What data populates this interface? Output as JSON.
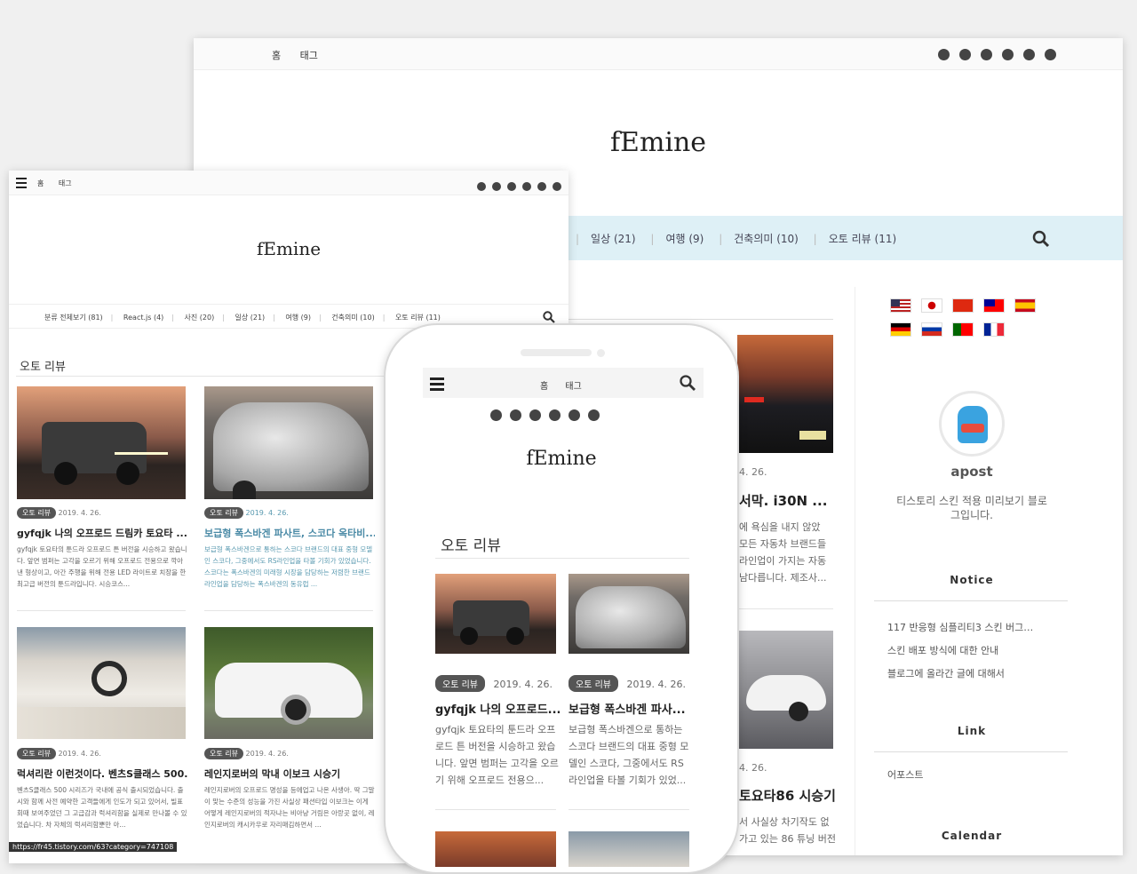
{
  "desktop": {
    "menu": [
      "홈",
      "태그"
    ],
    "logo": "fEmine",
    "nav": [
      "일상 (21)",
      "여행 (9)",
      "건축의미 (10)",
      "오토 리뷰 (11)"
    ],
    "post1_date": "4. 26.",
    "post1_title": "서막. i30N ...",
    "post1_excerpt": [
      "에 욕심을 내지 않았",
      "모든 자동차 브랜드들",
      "라인업이 가지는 자동",
      "남다릅니다. 제조사..."
    ],
    "post2_date": "4. 26.",
    "post2_title": "토요타86 시승기",
    "post2_excerpt": [
      "서 사실상 차기작도 없",
      "가고 있는 86 튜닝 버전"
    ],
    "profile_name": "apost",
    "profile_desc": "티스토리 스킨 적용 미리보기 블로그입니다.",
    "notice_title": "Notice",
    "notices": [
      "117 반응형 심플리티3 스킨 버그…",
      "스킨 배포 방식에 대한 안내",
      "블로그에 올라간 글에 대해서"
    ],
    "link_title": "Link",
    "links": [
      "어포스트"
    ],
    "calendar_title": "Calendar"
  },
  "tablet": {
    "menu": [
      "홈",
      "태그"
    ],
    "logo": "fEmine",
    "nav": [
      "분류 전체보기 (81)",
      "React.js (4)",
      "사진 (20)",
      "일상 (21)",
      "여행 (9)",
      "건축의미 (10)",
      "오토 리뷰 (11)"
    ],
    "category_heading": "오토 리뷰",
    "posts": [
      {
        "tag": "오토 리뷰",
        "date": "2019. 4. 26.",
        "title": "gyfqjk 나의 오프로드 드림카 토요타 ...",
        "excerpt": "gyfqjk 토요타의 툰드라 오프로드 튼 버전을 시승하고 왔습니다. 앞면 범퍼는 고각을 오르기 위해 오프로드 전용으로 깍아낸 형상이고, 아간 주행을 위해 전용 LED 라이트로 치장을 한 최고급 버전의 툰드라입니다. 시승코스..."
      },
      {
        "tag": "오토 리뷰",
        "date": "2019. 4. 26.",
        "title": "보급형 폭스바겐 파사트, 스코다 옥타비...",
        "excerpt": "보급형 폭스바겐으로 통하는 스코다 브랜드의 대표 중형 모델인 스코다, 그중에서도 RS라인업을 타볼 기회가 있었습니다. 스코다는 폭스바겐의 미래형 시장을 담당하는 저렴한 브랜드 라인업을 담당하는 폭스바겐의 동유럽 ..."
      },
      {
        "tag": "오토 리뷰",
        "date": "2019. 4. 26.",
        "title": "럭셔리란 이런것이다. 벤츠S클래스 500...",
        "excerpt": "벤츠S클래스 500 시리즈가 국내에 공식 출시되었습니다. 출시와 함께 사전 예약한 고객들에게 인도가 되고 있어서, 빌표회때 보여주었던 그 고급감과 럭셔리함을 실제로 만나볼 수 있었습니다. 차 자체의 럭셔리함뿐만 아..."
      },
      {
        "tag": "오토 리뷰",
        "date": "2019. 4. 26.",
        "title": "레인지로버의 막내 이보크 시승기",
        "excerpt": "레인지로버의 오프로드 명성을 등에업고 나온 사생아. 딱 그말이 맞는 수준의 성능을 가진 사실상 패션타입 이보크는 이게 어떻게 레인지로버의 적자냐는 비아냥 거림은 아랑곳 없이, 레인지로버의 캐시카우로 자리매김하면서 ..."
      }
    ]
  },
  "phone": {
    "menu": [
      "홈",
      "태그"
    ],
    "logo": "fEmine",
    "category_heading": "오토 리뷰",
    "posts": [
      {
        "tag": "오토 리뷰",
        "date": "2019. 4. 26.",
        "title": "gyfqjk 나의 오프로드...",
        "excerpt": "gyfqjk 토요타의 툰드라 오프로드 튼 버전을 시승하고 왔습니다. 앞면 범퍼는 고각을 오르기 위해 오프로드 전용으..."
      },
      {
        "tag": "오토 리뷰",
        "date": "2019. 4. 26.",
        "title": "보급형 폭스바겐 파사...",
        "excerpt": "보급형 폭스바겐으로 통하는 스코다 브랜드의 대표 중형 모델인 스코다, 그중에서도 RS 라인업을 타볼 기회가 있었..."
      }
    ]
  },
  "status_url": "https://fr45.tistory.com/63?category=747108",
  "colors": {
    "nav_bg": "#def0f6",
    "tag_bg": "#555555"
  }
}
